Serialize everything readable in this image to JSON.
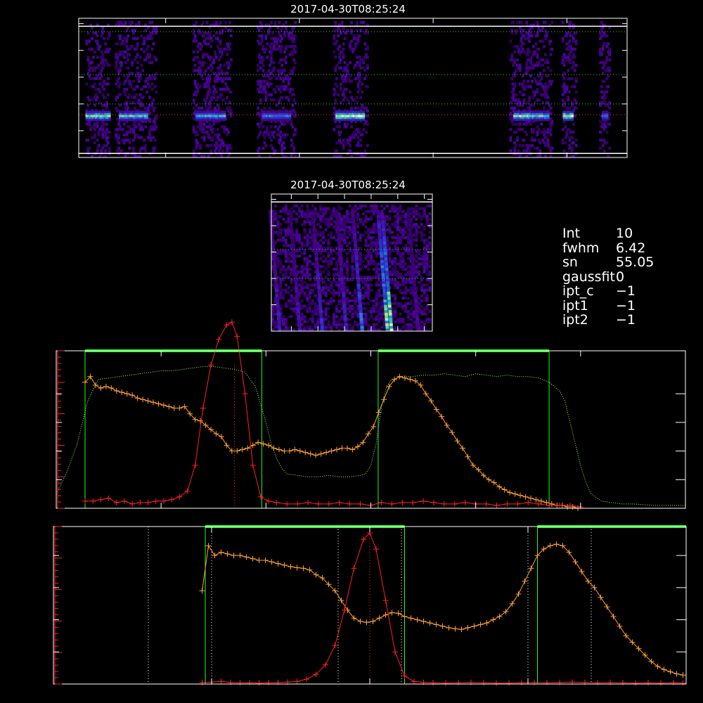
{
  "info": [
    {
      "key": "Int",
      "value": "10"
    },
    {
      "key": "fwhm",
      "value": "6.42"
    },
    {
      "key": "sn",
      "value": "55.05"
    },
    {
      "key": "gaussfit",
      "value": "0"
    },
    {
      "key": "ipt_c",
      "value": "−1"
    },
    {
      "key": "ipt1",
      "value": "−1"
    },
    {
      "key": "ipt2",
      "value": "−1"
    }
  ],
  "colors": {
    "spectrum": "#ffa030",
    "gaussian": "#ff2020",
    "window": "#20ff20",
    "transmission": "#a0ff60",
    "guide": "#ffff80",
    "frame": "#ffffff"
  },
  "chart_data": [
    {
      "type": "heatmap",
      "title": "2017-04-30T08:25:24",
      "xlim": [
        35,
        445
      ],
      "ylim": [
        520,
        624
      ],
      "xticks": [
        "100",
        "200",
        "300",
        "400"
      ],
      "xtick_values": [
        100,
        200,
        300,
        400
      ],
      "yticks": [
        "520",
        "540",
        "560",
        "580",
        "600",
        "620"
      ],
      "ytick_values": [
        520,
        540,
        560,
        580,
        600,
        620
      ],
      "hlines_dotted": [
        {
          "y": 552,
          "color": "red"
        },
        {
          "y": 560,
          "color": "green"
        },
        {
          "y": 582,
          "color": "green"
        },
        {
          "y": 614,
          "color": "green"
        }
      ],
      "hlines_solid": [
        523,
        618
      ],
      "bright_band_y": 552,
      "bright_segments": [
        [
          40,
          57,
          0.9
        ],
        [
          65,
          85,
          0.8
        ],
        [
          122,
          143,
          0.7
        ],
        [
          172,
          192,
          0.6
        ],
        [
          227,
          247,
          1.0
        ],
        [
          360,
          372,
          0.9
        ],
        [
          373,
          385,
          0.8
        ],
        [
          397,
          403,
          1.0
        ],
        [
          426,
          429,
          0.6
        ]
      ],
      "noise_columns": [
        [
          40,
          57
        ],
        [
          62,
          92
        ],
        [
          120,
          148
        ],
        [
          168,
          196
        ],
        [
          225,
          250
        ],
        [
          357,
          388
        ],
        [
          396,
          406
        ],
        [
          424,
          431
        ]
      ]
    },
    {
      "type": "heatmap",
      "title": "2017-04-30T08:25:24",
      "xlim": [
        745,
        866
      ],
      "ylim": [
        520,
        624
      ],
      "xticks": [
        "760",
        "780",
        "800",
        "820",
        "840",
        "860"
      ],
      "xtick_values": [
        760,
        780,
        800,
        820,
        840,
        860
      ],
      "yticks": [
        "520",
        "540",
        "560",
        "580",
        "600",
        "620"
      ],
      "ytick_values": [
        520,
        540,
        560,
        580,
        600,
        620
      ],
      "hlines_dotted": [
        582,
        560
      ],
      "hlines_solid": [
        618
      ],
      "streaks": [
        [
          750,
          0.4
        ],
        [
          765,
          0.35
        ],
        [
          782,
          0.45
        ],
        [
          800,
          0.4
        ],
        [
          812,
          0.6
        ],
        [
          831,
          0.9
        ],
        [
          834,
          1.0
        ],
        [
          854,
          0.3
        ]
      ]
    },
    {
      "type": "line",
      "xlim": [
        520,
        640
      ],
      "xticks": [
        "520",
        "540",
        "560",
        "580",
        "600",
        "620",
        "640"
      ],
      "xtick_values": [
        520,
        540,
        560,
        580,
        600,
        620,
        640
      ],
      "left_axis_outer": {
        "range": [
          0,
          1.1
        ],
        "ticks": [
          "0.0",
          "0.2",
          "0.4",
          "0.6",
          "0.8"
        ],
        "tick_values": [
          0,
          0.2,
          0.4,
          0.6,
          0.8
        ],
        "color": "#ffffff"
      },
      "left_axis_inner": {
        "range": [
          0,
          25
        ],
        "ticks": [
          "0",
          "5",
          "10",
          "15",
          "20",
          "25"
        ],
        "tick_values": [
          0,
          5,
          10,
          15,
          20,
          25
        ],
        "color": "#ff2020"
      },
      "windows": [
        [
          525.5,
          559.2
        ],
        [
          581.4,
          614.0
        ]
      ],
      "center_line_x": 554,
      "series": [
        {
          "style": "orange-cross",
          "x": [
            525.5,
            526.5,
            527.5,
            528.5,
            529.5,
            530.5,
            531.5,
            532.5,
            533.5,
            534.5,
            535.5,
            536.5,
            537.5,
            538.5,
            539.5,
            540.5,
            541.5,
            542.5,
            543.5,
            544.5,
            545.5,
            546.5,
            547.5,
            548.5,
            549.5,
            550.5,
            551.5,
            552.5,
            553.5,
            554.5,
            555.5,
            556.5,
            557.5,
            558.5,
            559.5,
            560.5,
            561.5,
            562.5,
            563.5,
            564.5,
            565.5,
            566.5,
            567.5,
            568.5,
            569.5,
            570.5,
            571.5,
            572.5,
            573.5,
            574.5,
            575.5,
            576.5,
            577.5,
            578.5,
            579.5,
            580.5,
            581.5,
            582.5,
            583.5,
            584.5,
            585.5,
            586.5,
            587.5,
            588.5,
            589.5,
            590.5,
            591.5,
            592.5,
            593.5,
            594.5,
            595.5,
            596.5,
            597.5,
            598.5,
            599.5,
            600.5,
            601.5,
            602.5,
            603.5,
            604.5,
            605.5,
            606.5,
            607.5,
            608.5,
            609.5,
            610.5,
            611.5,
            612.5,
            613.5,
            614.5,
            615.5,
            616.5,
            617.5,
            618.5,
            619.5
          ],
          "y": [
            0.88,
            0.92,
            0.86,
            0.84,
            0.85,
            0.84,
            0.82,
            0.81,
            0.8,
            0.79,
            0.77,
            0.76,
            0.75,
            0.74,
            0.73,
            0.72,
            0.71,
            0.7,
            0.7,
            0.71,
            0.66,
            0.62,
            0.61,
            0.58,
            0.55,
            0.52,
            0.5,
            0.44,
            0.4,
            0.4,
            0.41,
            0.42,
            0.44,
            0.46,
            0.45,
            0.44,
            0.42,
            0.41,
            0.4,
            0.4,
            0.41,
            0.4,
            0.39,
            0.38,
            0.37,
            0.38,
            0.39,
            0.4,
            0.41,
            0.42,
            0.42,
            0.41,
            0.43,
            0.46,
            0.52,
            0.57,
            0.67,
            0.76,
            0.85,
            0.9,
            0.92,
            0.91,
            0.9,
            0.89,
            0.86,
            0.8,
            0.75,
            0.69,
            0.64,
            0.58,
            0.53,
            0.47,
            0.42,
            0.36,
            0.3,
            0.27,
            0.23,
            0.2,
            0.18,
            0.15,
            0.13,
            0.11,
            0.1,
            0.09,
            0.08,
            0.07,
            0.06,
            0.05,
            0.04,
            0.03,
            0.02,
            0.02,
            0.01,
            0.01,
            0.0
          ]
        },
        {
          "style": "red-cross",
          "x": [
            525.5,
            527,
            528.5,
            530,
            531.5,
            533,
            534.5,
            536,
            537.5,
            539,
            540.5,
            542,
            543.5,
            545,
            546.5,
            548,
            549.5,
            551,
            552.5,
            553.5,
            554.5,
            556,
            557.5,
            559,
            560.5,
            562,
            564,
            566,
            568,
            570,
            572,
            574,
            576,
            578,
            580,
            582,
            584,
            586,
            588,
            590,
            592,
            594,
            596,
            598,
            600,
            602,
            604,
            606,
            608,
            610,
            612,
            614,
            616,
            618,
            620
          ],
          "y": [
            0.05,
            0.05,
            0.06,
            0.07,
            0.04,
            0.05,
            0.03,
            0.04,
            0.04,
            0.05,
            0.05,
            0.06,
            0.08,
            0.12,
            0.3,
            0.7,
            1.0,
            1.18,
            1.28,
            1.3,
            1.2,
            0.8,
            0.3,
            0.08,
            0.05,
            0.04,
            0.03,
            0.03,
            0.04,
            0.03,
            0.03,
            0.04,
            0.03,
            0.03,
            0.02,
            0.04,
            0.03,
            0.04,
            0.04,
            0.05,
            0.04,
            0.03,
            0.03,
            0.04,
            0.03,
            0.03,
            0.02,
            0.03,
            0.03,
            0.04,
            0.03,
            0.02,
            0.02,
            0.02,
            0.01
          ]
        },
        {
          "style": "green-dotted",
          "x": [
            520,
            522,
            524,
            526,
            528,
            530,
            532,
            534,
            536,
            538,
            540,
            542,
            544,
            546,
            548,
            550,
            552,
            554,
            556,
            558,
            560,
            561,
            562,
            563,
            564,
            566,
            568,
            570,
            572,
            574,
            576,
            578,
            579,
            580,
            581,
            582,
            583,
            584,
            586,
            588,
            590,
            592,
            594,
            596,
            598,
            600,
            602,
            604,
            606,
            608,
            610,
            612,
            614,
            616,
            617,
            618,
            619,
            620,
            621,
            622,
            624,
            626,
            628,
            630,
            634,
            638,
            640
          ],
          "y": [
            0.1,
            0.25,
            0.45,
            0.75,
            0.9,
            0.91,
            0.92,
            0.93,
            0.94,
            0.95,
            0.96,
            0.96,
            0.97,
            0.98,
            0.99,
            0.99,
            0.98,
            0.97,
            0.95,
            0.85,
            0.6,
            0.45,
            0.35,
            0.28,
            0.24,
            0.23,
            0.22,
            0.22,
            0.23,
            0.22,
            0.22,
            0.23,
            0.24,
            0.3,
            0.45,
            0.7,
            0.85,
            0.9,
            0.92,
            0.92,
            0.93,
            0.93,
            0.94,
            0.93,
            0.92,
            0.94,
            0.93,
            0.92,
            0.93,
            0.92,
            0.92,
            0.91,
            0.88,
            0.82,
            0.75,
            0.6,
            0.45,
            0.3,
            0.18,
            0.1,
            0.05,
            0.04,
            0.03,
            0.03,
            0.02,
            0.02,
            0.02
          ]
        }
      ]
    },
    {
      "type": "line",
      "xlim": [
        -10,
        10
      ],
      "xticks": [
        "−10",
        "−5",
        "0",
        "5",
        "10"
      ],
      "xtick_values": [
        -10,
        -5,
        0,
        5,
        10
      ],
      "left_axis_outer": {
        "range": [
          0,
          4.9
        ],
        "ticks": [
          "0",
          "1",
          "2",
          "3",
          "4"
        ],
        "tick_values": [
          0,
          1,
          2,
          3,
          4
        ],
        "color": "#ffffff"
      },
      "left_axis_inner": {
        "range": [
          0,
          25
        ],
        "ticks": [
          "0",
          "5",
          "10",
          "15",
          "20",
          "25"
        ],
        "tick_values": [
          0,
          5,
          10,
          15,
          20,
          25
        ],
        "color": "#ff2020"
      },
      "windows": [
        [
          -5.2,
          1.1
        ],
        [
          5.3,
          10
        ]
      ],
      "vlines_dotted": [
        -7,
        -5,
        -1,
        0,
        1,
        5,
        7
      ],
      "series": [
        {
          "style": "orange-cross",
          "x": [
            -5.3,
            -5.1,
            -4.9,
            -4.7,
            -4.5,
            -4.3,
            -4.1,
            -3.9,
            -3.7,
            -3.5,
            -3.3,
            -3.1,
            -2.9,
            -2.7,
            -2.5,
            -2.3,
            -2.1,
            -1.9,
            -1.7,
            -1.5,
            -1.3,
            -1.1,
            -0.9,
            -0.7,
            -0.5,
            -0.3,
            -0.1,
            0.1,
            0.3,
            0.5,
            0.7,
            0.9,
            1.1,
            1.3,
            1.5,
            1.7,
            1.9,
            2.1,
            2.3,
            2.5,
            2.7,
            2.9,
            3.1,
            3.3,
            3.5,
            3.7,
            3.9,
            4.1,
            4.3,
            4.5,
            4.7,
            4.9,
            5.1,
            5.3,
            5.5,
            5.7,
            5.9,
            6.1,
            6.3,
            6.5,
            6.7,
            6.9,
            7.1,
            7.3,
            7.5,
            7.7,
            7.9,
            8.1,
            8.3,
            8.5,
            8.7,
            8.9,
            9.1,
            9.3,
            9.5,
            9.7,
            9.9
          ],
          "y": [
            2.9,
            4.3,
            4.0,
            4.1,
            4.05,
            4.0,
            4.0,
            3.95,
            3.9,
            3.85,
            3.85,
            3.8,
            3.75,
            3.7,
            3.65,
            3.62,
            3.6,
            3.55,
            3.4,
            3.3,
            3.1,
            2.9,
            2.6,
            2.3,
            2.05,
            1.95,
            1.92,
            1.95,
            2.05,
            2.15,
            2.22,
            2.2,
            2.1,
            2.05,
            2.0,
            1.95,
            1.9,
            1.85,
            1.8,
            1.75,
            1.72,
            1.7,
            1.75,
            1.8,
            1.85,
            1.9,
            2.0,
            2.1,
            2.25,
            2.5,
            2.8,
            3.2,
            3.6,
            4.0,
            4.2,
            4.3,
            4.35,
            4.3,
            4.1,
            3.8,
            3.5,
            3.2,
            3.0,
            2.7,
            2.4,
            2.1,
            1.8,
            1.5,
            1.3,
            1.1,
            0.9,
            0.7,
            0.55,
            0.45,
            0.38,
            0.32,
            0.28
          ]
        },
        {
          "style": "red-cross",
          "x": [
            -5.3,
            -5.0,
            -4.7,
            -4.4,
            -4.1,
            -3.8,
            -3.5,
            -3.2,
            -2.9,
            -2.6,
            -2.3,
            -2.0,
            -1.7,
            -1.4,
            -1.1,
            -0.8,
            -0.5,
            -0.2,
            0.0,
            0.2,
            0.5,
            0.8,
            1.1,
            1.4,
            1.7,
            2.0,
            2.4,
            2.8,
            3.2,
            3.6,
            4.0,
            4.4,
            4.8,
            5.2,
            5.6,
            6.0,
            6.4,
            6.8,
            7.2,
            7.6,
            8.0,
            8.4,
            8.8,
            9.2,
            9.6,
            9.9
          ],
          "y": [
            0.05,
            0.06,
            0.08,
            0.05,
            0.04,
            0.04,
            0.03,
            0.04,
            0.05,
            0.06,
            0.08,
            0.15,
            0.3,
            0.6,
            1.2,
            2.3,
            3.6,
            4.5,
            4.7,
            4.2,
            2.6,
            1.0,
            0.25,
            0.08,
            0.05,
            0.04,
            0.03,
            0.04,
            0.05,
            0.04,
            0.03,
            0.03,
            0.04,
            0.05,
            0.04,
            0.05,
            0.06,
            0.05,
            0.04,
            0.05,
            0.04,
            0.03,
            0.04,
            0.03,
            0.04,
            0.03
          ]
        }
      ]
    }
  ]
}
